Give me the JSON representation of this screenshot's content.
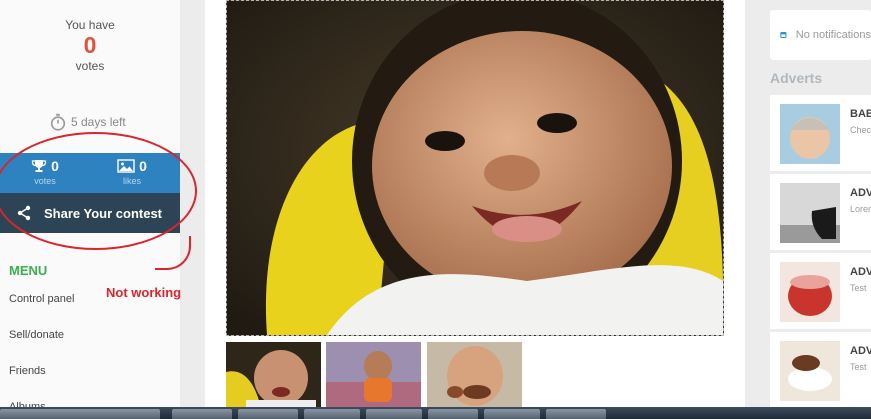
{
  "sidebar": {
    "votes_line1": "You have",
    "votes_count": "0",
    "votes_line3": "votes",
    "timer_text": "5 days left",
    "stats": {
      "votes_num": "0",
      "votes_label": "votes",
      "likes_num": "0",
      "likes_label": "likes"
    },
    "share_label": "Share Your contest",
    "menu_title": "MENU",
    "menu_items": [
      "Control panel",
      "Sell/donate",
      "Friends",
      "Albums"
    ],
    "annotation_text": "Not working"
  },
  "right": {
    "notification_text": "No notifications",
    "adverts_title": "Adverts",
    "adverts": [
      {
        "title": "BABY",
        "sub": "Check"
      },
      {
        "title": "ADVE",
        "sub": "Lorem"
      },
      {
        "title": "ADVE",
        "sub": "Test"
      },
      {
        "title": "ADVE",
        "sub": "Test"
      }
    ]
  },
  "colors": {
    "accent_green": "#37b24d",
    "vote_count_red": "#e0533a",
    "stats_blue": "#2d82bf",
    "share_dark": "#2c4456",
    "annotation_red": "#d8262c"
  }
}
